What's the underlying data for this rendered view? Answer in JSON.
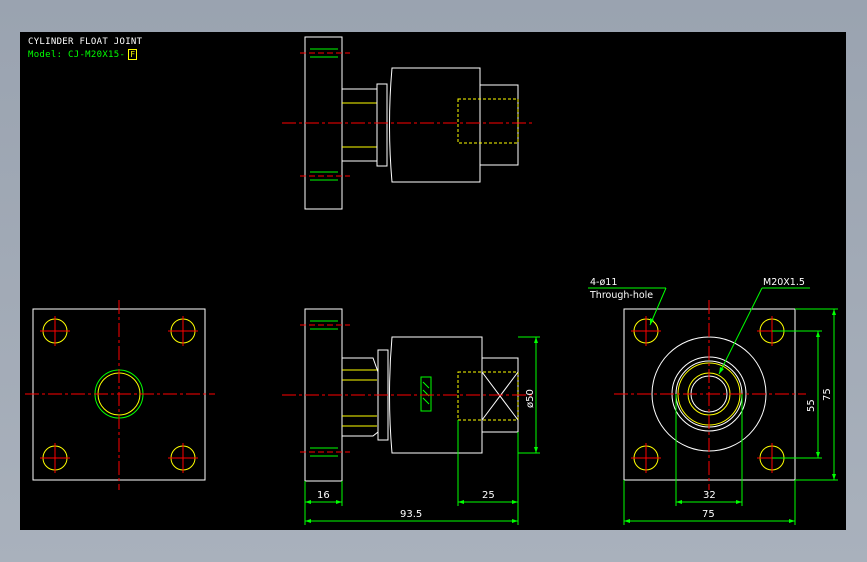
{
  "drawing": {
    "title": "CYLINDER FLOAT JOINT",
    "model_prefix": "Model: CJ-M20X15-",
    "model_flag": "F"
  },
  "dimensions": {
    "d16": "16",
    "d25": "25",
    "d93_5": "93.5",
    "d50": "ø50",
    "d32": "32",
    "d75_h": "75",
    "d55": "55",
    "d75_v": "75"
  },
  "notes": {
    "holes": "4-ø11",
    "through": "Through-hole",
    "thread": "M20X1.5"
  },
  "colors": {
    "canvas": "#000000",
    "outline": "#ffffff",
    "centerline": "#ff0000",
    "hidden": "#ffff00",
    "dimension": "#00ff00"
  }
}
